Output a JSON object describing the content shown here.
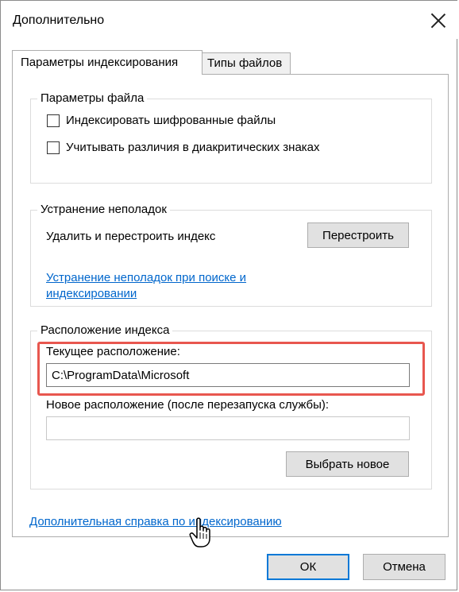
{
  "window": {
    "title": "Дополнительно"
  },
  "tabs": [
    {
      "label": "Параметры индексирования"
    },
    {
      "label": "Типы файлов"
    }
  ],
  "file_settings": {
    "legend": "Параметры файла",
    "checkboxes": [
      {
        "label": "Индексировать шифрованные файлы",
        "checked": false
      },
      {
        "label": "Учитывать различия в диакритических знаках",
        "checked": false
      }
    ]
  },
  "troubleshooting": {
    "legend": "Устранение неполадок",
    "rebuild_text": "Удалить и перестроить индекс",
    "rebuild_button": "Перестроить",
    "link_line1": "Устранение неполадок при поиске и",
    "link_line2": "индексировании"
  },
  "index_location": {
    "legend": "Расположение индекса",
    "current_label": "Текущее расположение:",
    "current_value": "C:\\ProgramData\\Microsoft",
    "new_label": "Новое расположение (после перезапуска службы):",
    "new_value": "",
    "select_button": "Выбрать новое"
  },
  "footer": {
    "help_link": "Дополнительная справка по индексированию",
    "ok_button": "ОК",
    "cancel_button": "Отмена"
  },
  "colors": {
    "accent": "#0078d7",
    "link": "#0066cc",
    "highlight": "#e8574f"
  }
}
